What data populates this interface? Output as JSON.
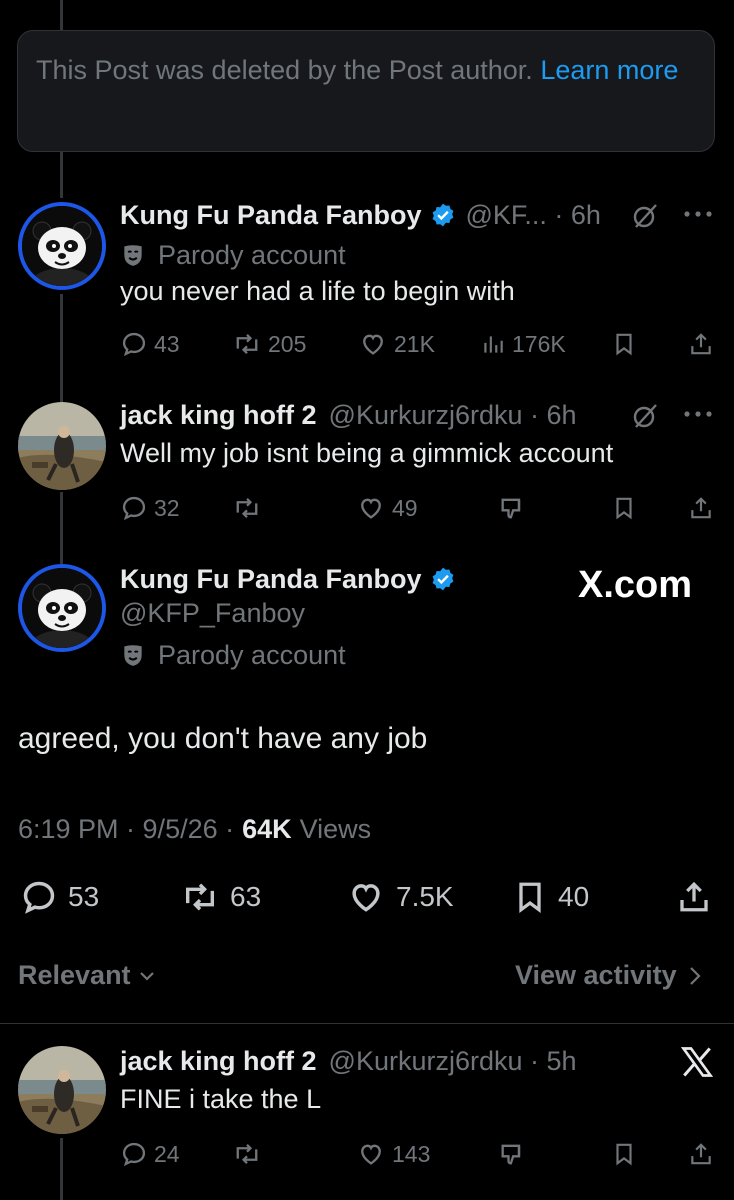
{
  "deleted_notice": {
    "text": "This Post was deleted by the Post author.",
    "link": "Learn more"
  },
  "reply1": {
    "name": "Kung Fu Panda Fanboy",
    "handle": "@KF... · 6h",
    "label": "Parody account",
    "text": "you never had a life to begin with",
    "replies": "43",
    "reposts": "205",
    "likes": "21K",
    "views": "176K"
  },
  "reply2": {
    "name": "jack king hoff 2",
    "handle": "@Kurkurzj6rdku · 6h",
    "text": "Well my job isnt being a gimmick account",
    "replies": "32",
    "reposts": "",
    "likes": "49"
  },
  "main": {
    "name": "Kung Fu Panda Fanboy",
    "handle": "@KFP_Fanboy",
    "label": "Parody account",
    "watermark": "X.com",
    "text": "agreed, you don't have any job",
    "time": "6:19 PM · 9/5/26 ·",
    "views_count": "64K",
    "views_label": "Views",
    "replies": "53",
    "reposts": "63",
    "likes": "7.5K",
    "bookmarks": "40"
  },
  "sort": {
    "label": "Relevant",
    "activity": "View activity"
  },
  "reply3": {
    "name": "jack king hoff 2",
    "handle": "@Kurkurzj6rdku · 5h",
    "text": "FINE i take the L",
    "replies": "24",
    "likes": "143"
  },
  "colors": {
    "accent": "#1d9bf0",
    "ring": "#1d57e8",
    "background": "#000000",
    "muted": "#71767b"
  }
}
